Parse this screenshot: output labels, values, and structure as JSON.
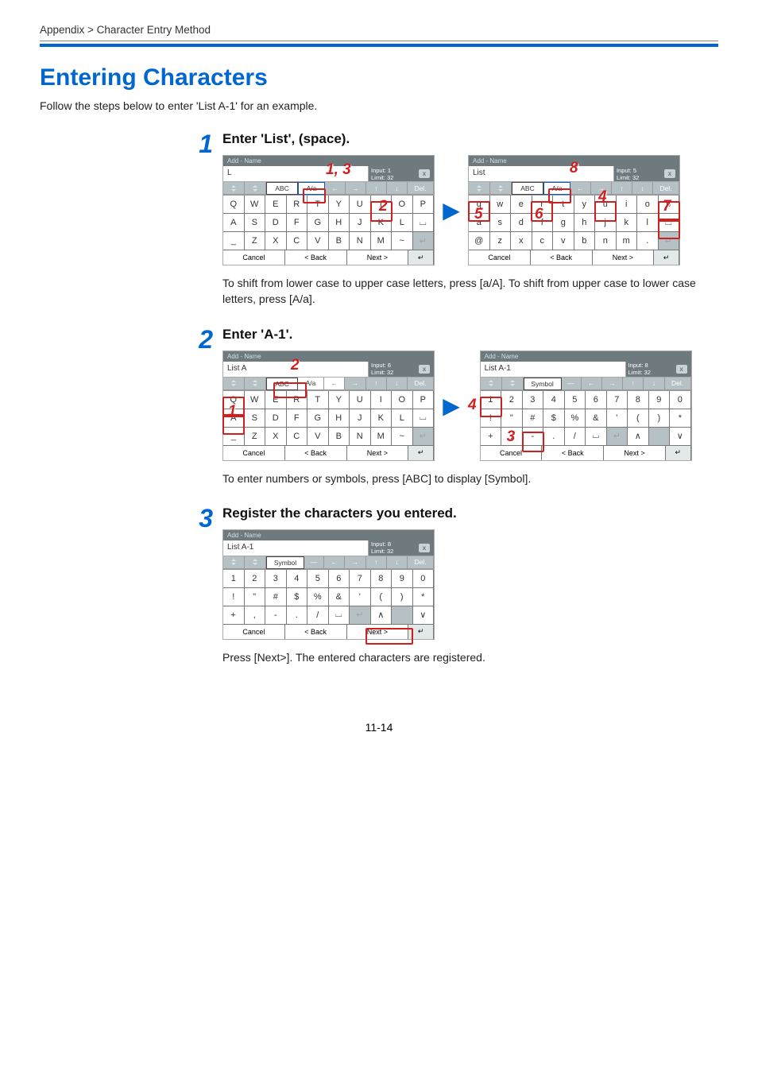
{
  "breadcrumb": "Appendix > Character Entry Method",
  "title": "Entering Characters",
  "lead": "Follow the steps below to enter 'List A-1' for an example.",
  "page_number": "11-14",
  "steps": {
    "s1": {
      "num": "1",
      "heading": "Enter 'List', (space).",
      "note": "To shift from lower case to upper case letters, press [a/A]. To shift from upper case to lower case letters, press [A/a]."
    },
    "s2": {
      "num": "2",
      "heading": "Enter 'A-1'.",
      "note": "To enter numbers or symbols, press [ABC] to display [Symbol]."
    },
    "s3": {
      "num": "3",
      "heading": "Register the characters you entered.",
      "note": "Press [Next>]. The entered characters are registered."
    }
  },
  "panel": {
    "title": "Add - Name",
    "right_input_label": "Input:",
    "right_limit_label": "Limit:",
    "limit_value": "32",
    "btn_cancel": "Cancel",
    "btn_back": "< Back",
    "btn_next": "Next >",
    "mode_abc": "ABC",
    "mode_Aa": "A/a",
    "mode_symbol": "Symbol",
    "mode_del": "Del."
  },
  "panels": {
    "p1": {
      "field": "L",
      "input_n": "1"
    },
    "p2": {
      "field": "List",
      "input_n": "5"
    },
    "p3": {
      "field": "List A",
      "input_n": "6"
    },
    "p4": {
      "field": "List A-1",
      "input_n": "8"
    },
    "p5": {
      "field": "List A-1",
      "input_n": "8"
    }
  },
  "kb_upper": {
    "r0": [
      "Q",
      "W",
      "E",
      "R",
      "T",
      "Y",
      "U",
      "I",
      "O",
      "P"
    ],
    "r1": [
      "A",
      "S",
      "D",
      "F",
      "G",
      "H",
      "J",
      "K",
      "L",
      "␣"
    ],
    "r2": [
      "_",
      "Z",
      "X",
      "C",
      "V",
      "B",
      "N",
      "M",
      "~",
      "↵"
    ]
  },
  "kb_lower": {
    "r0": [
      "q",
      "w",
      "e",
      "r",
      "t",
      "y",
      "u",
      "i",
      "o",
      "p"
    ],
    "r1": [
      "a",
      "s",
      "d",
      "f",
      "g",
      "h",
      "j",
      "k",
      "l",
      "␣"
    ],
    "r2": [
      "@",
      "z",
      "x",
      "c",
      "v",
      "b",
      "n",
      "m",
      ".",
      "↵"
    ]
  },
  "kb_sym": {
    "r0": [
      "1",
      "2",
      "3",
      "4",
      "5",
      "6",
      "7",
      "8",
      "9",
      "0"
    ],
    "r1": [
      "!",
      "\"",
      "#",
      "$",
      "%",
      "&",
      "'",
      "(",
      ")",
      "*"
    ],
    "r2": [
      "+",
      ",",
      "-",
      ".",
      "/",
      "␣",
      "↵",
      "∧",
      "",
      "∨"
    ]
  },
  "annot": {
    "a13": "1, 3",
    "a2": "2",
    "a4": "4",
    "a5": "5",
    "a6": "6",
    "a7": "7",
    "a8": "8",
    "a2b": "2",
    "a3b": "3"
  }
}
